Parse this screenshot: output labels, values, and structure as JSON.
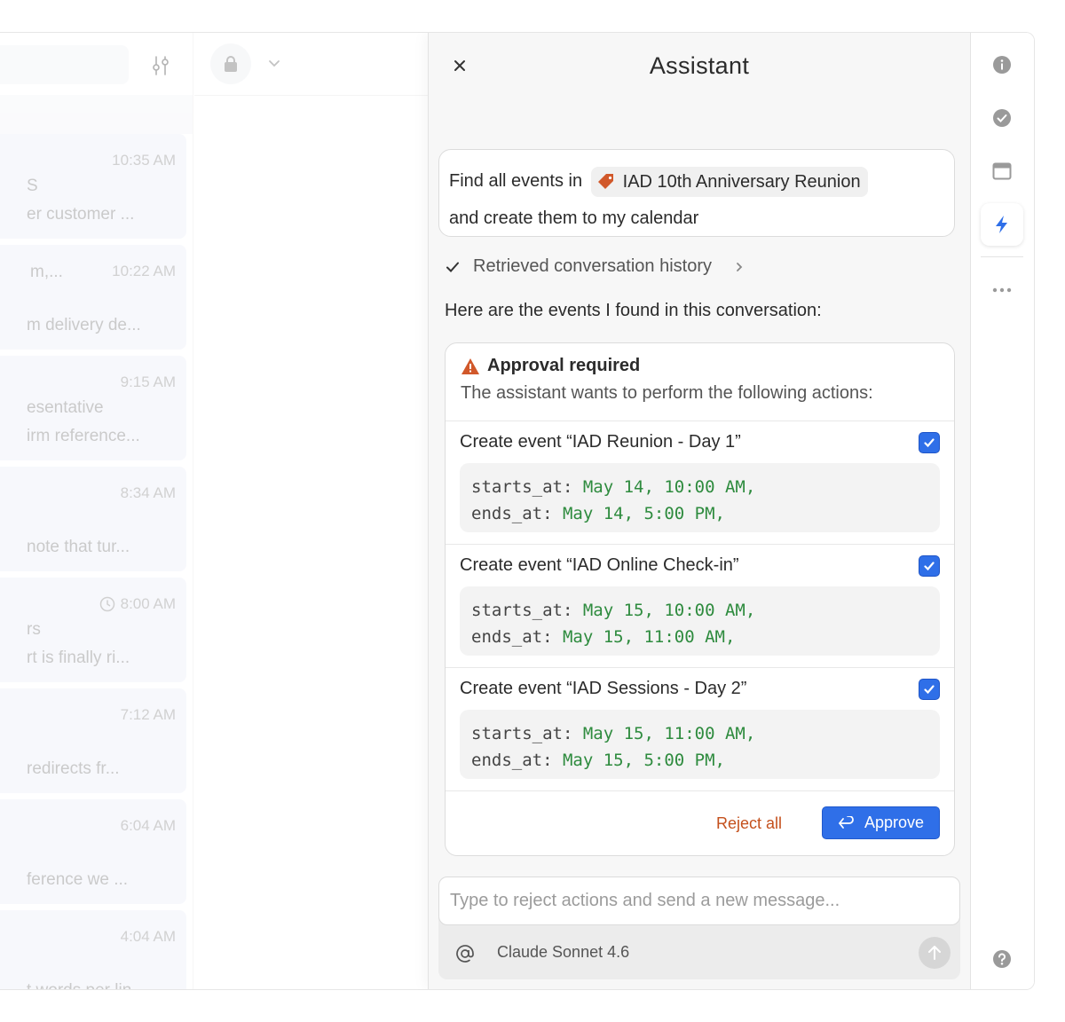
{
  "inbox": {
    "messages": [
      {
        "time": "10:35 AM",
        "line1": "S",
        "line2": "er customer ..."
      },
      {
        "time": "10:22 AM",
        "title": "m,...",
        "line2": "m delivery de..."
      },
      {
        "time": "9:15 AM",
        "line1": "esentative",
        "line2": "irm reference..."
      },
      {
        "time": "8:34 AM",
        "line2": "note that tur..."
      },
      {
        "time": "8:00 AM",
        "line1": "rs",
        "line2": "rt is finally ri..."
      },
      {
        "time": "7:12 AM",
        "line2": "redirects fr..."
      },
      {
        "time": "6:04 AM",
        "line2": "ference we ..."
      },
      {
        "time": "4:04 AM",
        "line2": "t words per lin..."
      }
    ]
  },
  "assistant": {
    "title": "Assistant",
    "prompt": {
      "before": "Find all events in",
      "chip_label": "IAD 10th Anniversary Reunion",
      "after": "and create them to my calendar"
    },
    "retrieved_label": "Retrieved conversation history",
    "intro": "Here are the events I found in this conversation:",
    "approval": {
      "title": "Approval required",
      "subtitle": "The assistant wants to perform the following actions:",
      "events": [
        {
          "title": "Create event “IAD Reunion - Day 1”",
          "checked": true,
          "starts_key": "starts_at:",
          "starts_val": "May 14, 10:00 AM,",
          "ends_key": "ends_at:",
          "ends_val": "May 14, 5:00 PM,"
        },
        {
          "title": "Create event “IAD Online Check-in”",
          "checked": true,
          "starts_key": "starts_at:",
          "starts_val": "May 15, 10:00 AM,",
          "ends_key": "ends_at:",
          "ends_val": "May 15, 11:00 AM,"
        },
        {
          "title": "Create event “IAD Sessions - Day 2”",
          "checked": true,
          "starts_key": "starts_at:",
          "starts_val": "May 15, 11:00 AM,",
          "ends_key": "ends_at:",
          "ends_val": "May 15, 5:00 PM,"
        }
      ],
      "reject_label": "Reject all",
      "approve_label": "Approve"
    },
    "composer": {
      "placeholder": "Type to reject actions and send a new message...",
      "model": "Claude Sonnet 4.6"
    }
  },
  "rail": {
    "icons": [
      "info-icon",
      "check-circle-icon",
      "window-icon",
      "lightning-icon",
      "more-icon",
      "help-icon"
    ]
  },
  "colors": {
    "accent": "#2f6fe8",
    "warning": "#d1582a",
    "reject": "#c4501c",
    "code_value": "#2e8b3e"
  }
}
